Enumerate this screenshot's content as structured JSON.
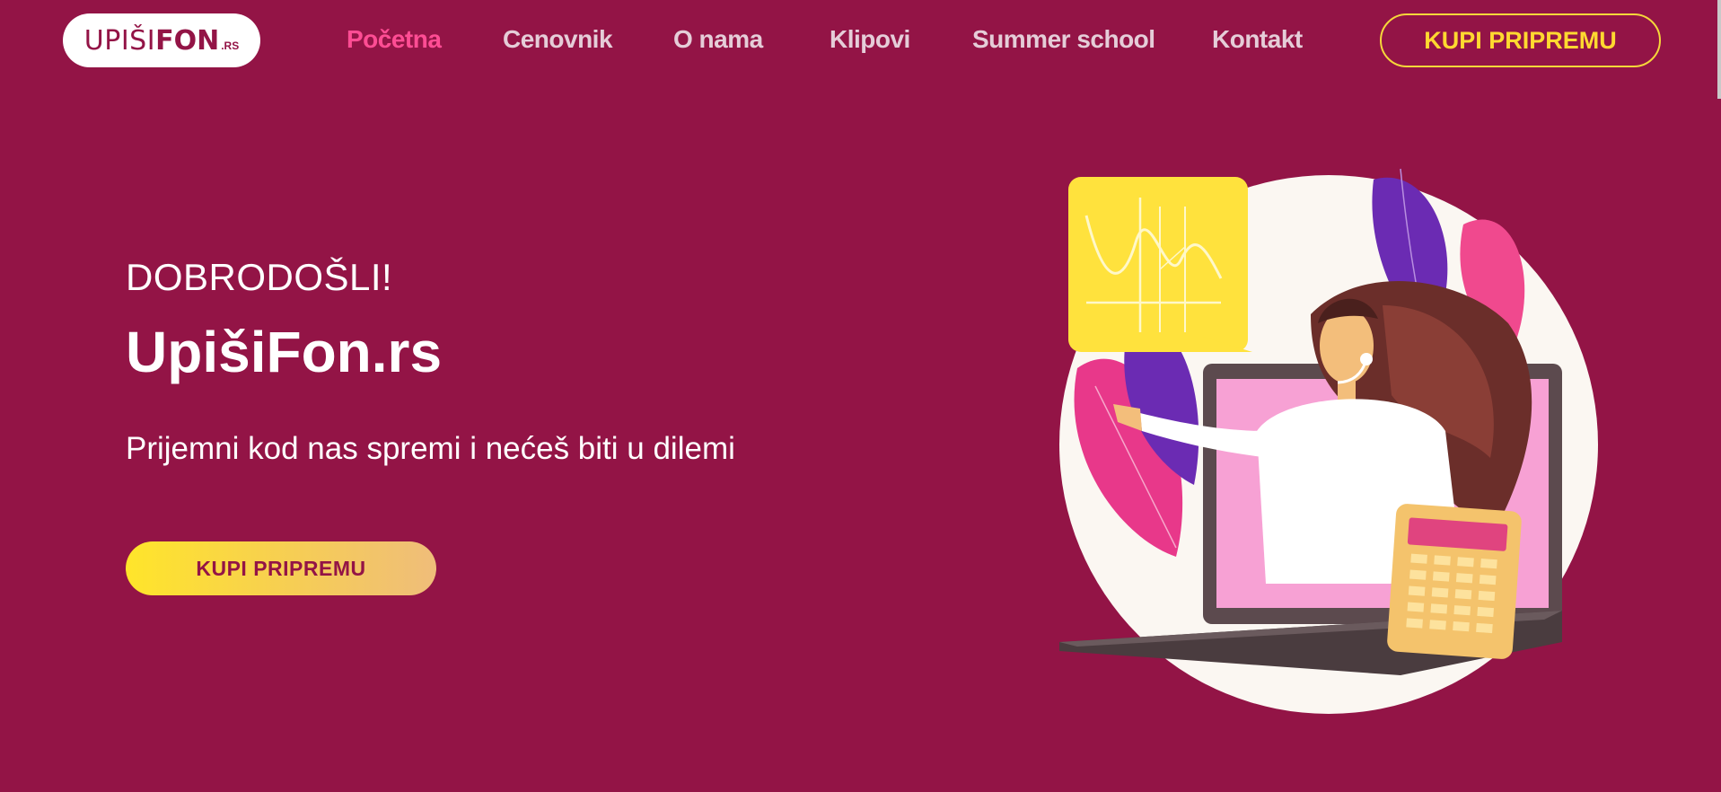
{
  "header": {
    "logo": {
      "text_main": "UPIŠI",
      "text_bold": "FON",
      "text_suffix": ".RS"
    },
    "nav": [
      {
        "label": "Početna",
        "active": true
      },
      {
        "label": "Cenovnik",
        "active": false
      },
      {
        "label": "O nama",
        "active": false
      },
      {
        "label": "Klipovi",
        "active": false
      },
      {
        "label": "Summer school",
        "active": false
      },
      {
        "label": "Kontakt",
        "active": false
      }
    ],
    "cta_label": "KUPI PRIPREMU"
  },
  "hero": {
    "welcome": "DOBRODOŠLI!",
    "title": "UpišiFon.rs",
    "subtitle": "Prijemni kod nas spremi i nećeš biti u dilemi",
    "cta_label": "KUPI PRIPREMU",
    "illustration": "woman-with-laptop-and-calculator-illustration"
  },
  "colors": {
    "background": "#931446",
    "nav_active": "#ff4d94",
    "nav_text": "#e5cdd8",
    "accent_yellow": "#ffd930",
    "white": "#ffffff"
  }
}
